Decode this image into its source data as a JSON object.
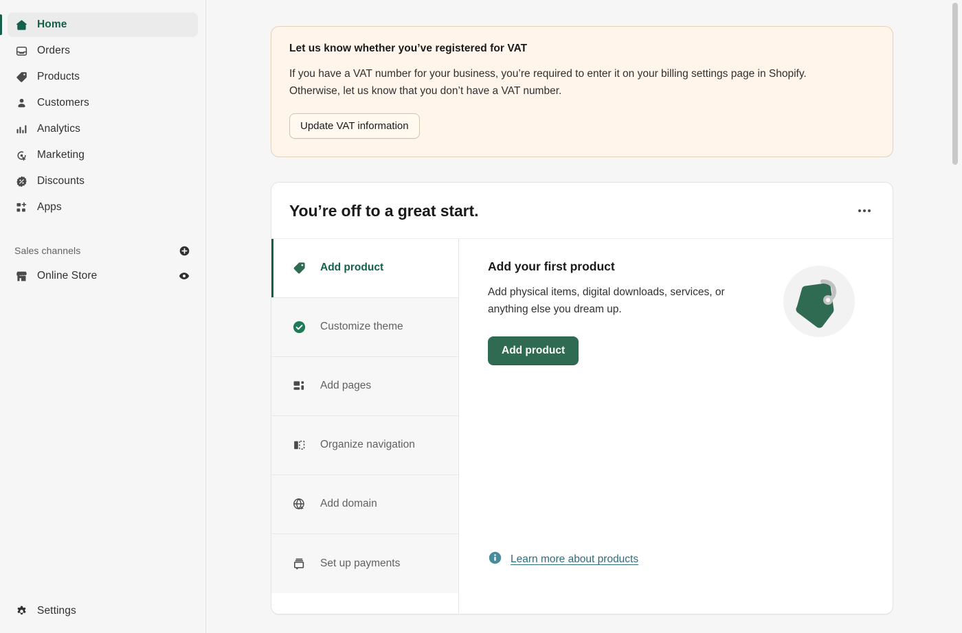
{
  "sidebar": {
    "nav": [
      {
        "label": "Home",
        "icon": "home-icon",
        "active": true
      },
      {
        "label": "Orders",
        "icon": "orders-inbox-icon",
        "active": false
      },
      {
        "label": "Products",
        "icon": "product-tag-icon",
        "active": false
      },
      {
        "label": "Customers",
        "icon": "customer-person-icon",
        "active": false
      },
      {
        "label": "Analytics",
        "icon": "analytics-bars-icon",
        "active": false
      },
      {
        "label": "Marketing",
        "icon": "marketing-target-cursor-icon",
        "active": false
      },
      {
        "label": "Discounts",
        "icon": "discount-percent-icon",
        "active": false
      },
      {
        "label": "Apps",
        "icon": "apps-grid-plus-icon",
        "active": false
      }
    ],
    "sales_channels": {
      "title": "Sales channels",
      "add_icon": "plus-circle-icon",
      "items": [
        {
          "label": "Online Store",
          "icon": "storefront-icon",
          "action_icon": "eye-view-icon"
        }
      ]
    },
    "footer": {
      "label": "Settings",
      "icon": "gear-icon"
    }
  },
  "banner": {
    "title": "Let us know whether you’ve registered for VAT",
    "body": "If you have a VAT number for your business, you’re required to enter it on your billing settings page in Shopify. Otherwise, let us know that you don’t have a VAT number.",
    "button_label": "Update VAT information",
    "background": "#fff5ea",
    "border_color": "#e1d2b8"
  },
  "setup_card": {
    "title": "You’re off to a great start.",
    "more_icon": "ellipsis-horizontal-icon",
    "steps": [
      {
        "label": "Add product",
        "icon": "product-tag-icon",
        "state": "active"
      },
      {
        "label": "Customize theme",
        "icon": "check-circle-filled-icon",
        "state": "done"
      },
      {
        "label": "Add pages",
        "icon": "pages-layout-icon",
        "state": "todo"
      },
      {
        "label": "Organize navigation",
        "icon": "navigation-panel-icon",
        "state": "todo"
      },
      {
        "label": "Add domain",
        "icon": "globe-domain-icon",
        "state": "todo"
      },
      {
        "label": "Set up payments",
        "icon": "payments-card-icon",
        "state": "todo"
      }
    ],
    "detail": {
      "title": "Add your first product",
      "description": "Add physical items, digital downloads, services, or anything else you dream up.",
      "button_label": "Add product",
      "illustration": "product-tag-illustration",
      "learn_more": {
        "label": "Learn more about products",
        "icon": "info-circle-icon",
        "color": "#2e6b7d"
      }
    }
  },
  "colors": {
    "brand_green": "#14604a",
    "primary_button": "#2f6a53",
    "page_background": "#f6f6f7",
    "card_background": "#ffffff",
    "link": "#2e6b7d"
  }
}
